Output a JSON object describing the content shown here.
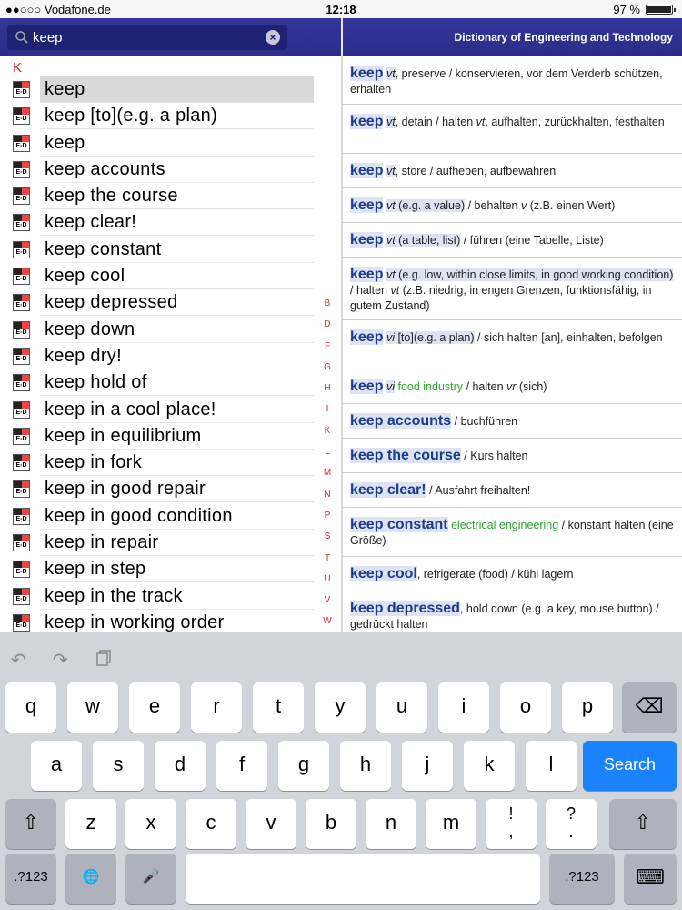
{
  "status": {
    "carrier": "●●○○○ Vodafone.de",
    "time": "12:18",
    "battery": "97 %"
  },
  "search": {
    "value": "keep",
    "clear_icon": "clear-icon"
  },
  "header": {
    "title": "Dictionary of Engineering and Technology"
  },
  "list": {
    "section": "K",
    "flag_label": "E-D",
    "items": [
      "keep",
      "keep [to](e.g. a plan)",
      "keep",
      "keep accounts",
      "keep the course",
      "keep clear!",
      "keep constant",
      "keep cool",
      "keep depressed",
      "keep down",
      "keep dry!",
      "keep hold of",
      "keep in a cool place!",
      "keep in equilibrium",
      "keep in fork",
      "keep in good repair",
      "keep in good condition",
      "keep in repair",
      "keep in step",
      "keep in the track",
      "keep in working order"
    ],
    "index": [
      "B",
      "D",
      "F",
      "G",
      "H",
      "I",
      "K",
      "L",
      "M",
      "N",
      "P",
      "S",
      "T",
      "U",
      "V",
      "W"
    ]
  },
  "entries": [
    {
      "term": "keep",
      "pos": "vt",
      "text1": ", preserve / konservieren, vor dem Verderb schützen, erhalten"
    },
    {
      "term": "keep",
      "pos": "vt",
      "text1": ", detain / halten ",
      "pos2": "vt",
      "text2": ", aufhalten, zurückhalten, festhalten"
    },
    {
      "term": "keep",
      "pos": "vt",
      "text1": ", store / aufheben, aufbewahren"
    },
    {
      "term": "keep",
      "pos": "vt",
      "hl": "(e.g. a value)",
      "text1": " / behalten ",
      "pos2": "v",
      "text2": " (z.B. einen Wert)"
    },
    {
      "term": "keep",
      "pos": "vt",
      "hl": "(a table, list)",
      "text1": " / führen (eine Tabelle, Liste)"
    },
    {
      "term": "keep",
      "pos": "vt",
      "hl": "(e.g. low, within close limits, in good working condition)",
      "text1": " / halten ",
      "pos2": "vt",
      "text2": " (z.B. niedrig, in engen Grenzen, funktionsfähig, in gutem Zustand)"
    },
    {
      "term": "keep",
      "pos": "vi",
      "hl": "[to](e.g. a plan)",
      "text1": " / sich halten [an], einhalten, befolgen"
    },
    {
      "term": "keep",
      "pos": "vi",
      "field": "food industry",
      "text1": " / halten ",
      "pos2": "vr",
      "text2": " (sich)"
    },
    {
      "term": "keep accounts",
      "text1": " / buchführen"
    },
    {
      "term": "keep the course",
      "text1": " / Kurs halten"
    },
    {
      "term": "keep clear!",
      "text1": " / Ausfahrt freihalten!"
    },
    {
      "term": "keep constant",
      "field": "electrical engineering",
      "text1": " / konstant halten (eine Größe)"
    },
    {
      "term": "keep cool",
      "text1": ", refrigerate (food) / kühl lagern"
    },
    {
      "term": "keep depressed",
      "text1": ", hold down (e.g. a key, mouse button) / gedrückt halten"
    }
  ],
  "keyboard": {
    "row1": [
      "q",
      "w",
      "e",
      "r",
      "t",
      "y",
      "u",
      "i",
      "o",
      "p"
    ],
    "row2": [
      "a",
      "s",
      "d",
      "f",
      "g",
      "h",
      "j",
      "k",
      "l"
    ],
    "row3": [
      "z",
      "x",
      "c",
      "v",
      "b",
      "n",
      "m",
      "!\n,",
      "?\n."
    ],
    "search_label": "Search",
    "numbers_label": ".?123"
  }
}
